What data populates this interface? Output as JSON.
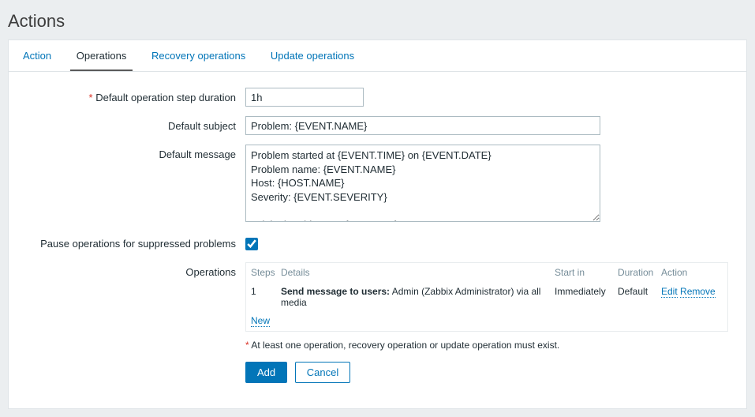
{
  "page": {
    "title": "Actions"
  },
  "tabs": [
    {
      "label": "Action",
      "active": false
    },
    {
      "label": "Operations",
      "active": true
    },
    {
      "label": "Recovery operations",
      "active": false
    },
    {
      "label": "Update operations",
      "active": false
    }
  ],
  "form": {
    "step_duration_label": "Default operation step duration",
    "step_duration_value": "1h",
    "subject_label": "Default subject",
    "subject_value": "Problem: {EVENT.NAME}",
    "message_label": "Default message",
    "message_value": "Problem started at {EVENT.TIME} on {EVENT.DATE}\nProblem name: {EVENT.NAME}\nHost: {HOST.NAME}\nSeverity: {EVENT.SEVERITY}\n\nOriginal problem ID: {EVENT.ID}\n{TRIGGER.URL}",
    "pause_label": "Pause operations for suppressed problems",
    "pause_checked": true,
    "operations_label": "Operations",
    "hint_asterisk": "*",
    "hint_text": " At least one operation, recovery operation or update operation must exist."
  },
  "ops_table": {
    "headers": {
      "steps": "Steps",
      "details": "Details",
      "start": "Start in",
      "duration": "Duration",
      "action": "Action"
    },
    "rows": [
      {
        "steps": "1",
        "details_bold": "Send message to users:",
        "details_rest": " Admin (Zabbix Administrator) via all media",
        "start": "Immediately",
        "duration": "Default",
        "edit": "Edit",
        "remove": "Remove"
      }
    ],
    "new_label": "New"
  },
  "buttons": {
    "add": "Add",
    "cancel": "Cancel"
  }
}
